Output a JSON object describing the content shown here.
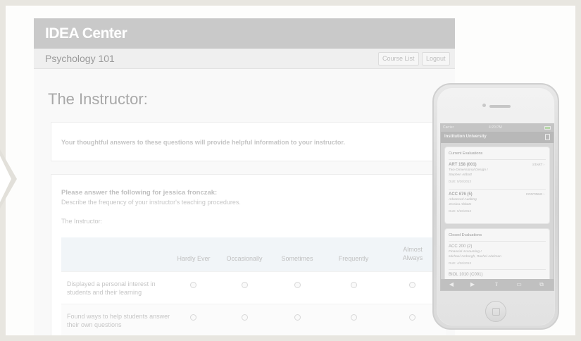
{
  "app": {
    "brand": "IDEA Center",
    "course_title": "Psychology 101",
    "course_list_label": "Course List",
    "logout_label": "Logout",
    "page_title": "The Instructor:",
    "intro_text": "Your thoughtful answers to these questions will provide helpful information to your instructor.",
    "question_heading": "Please answer the following for jessica fronczak:",
    "question_sub": "Describe the frequency of your instructor's teaching procedures.",
    "instructor_label": "The Instructor:",
    "scale": [
      "Hardly Ever",
      "Occasionally",
      "Sometimes",
      "Frequently",
      "Almost Always"
    ],
    "questions": [
      "Displayed a personal interest in students and their learning",
      "Found ways to help students answer their own questions"
    ]
  },
  "phone": {
    "status": {
      "carrier": "Carrier",
      "time": "4:20 PM"
    },
    "nav_title": "Institution University",
    "current_title": "Current Evaluations",
    "current": [
      {
        "course": "ART 158 (001)",
        "action": "START ›",
        "line1": "Two-Dimensional Design I",
        "line2": "Stephen Abbott",
        "due": "DUE: 5/26/2013"
      },
      {
        "course": "ACC 676 (5)",
        "action": "CONTINUE ›",
        "line1": "Advanced Auditing",
        "line2": "Jessica Abbate",
        "due": "DUE: 5/26/2013"
      }
    ],
    "closed_title": "Closed Evaluations",
    "closed": [
      {
        "course": "ACC 200 (2)",
        "line1": "Financial Accounting I",
        "line2": "Michael Amborgh, Rachel Adelman",
        "due": "DUE: 4/26/2013"
      },
      {
        "course": "BIOL 1010 (C001)"
      }
    ],
    "toolbar": [
      "◀",
      "▶",
      "⇪",
      "▭",
      "⧉"
    ]
  }
}
